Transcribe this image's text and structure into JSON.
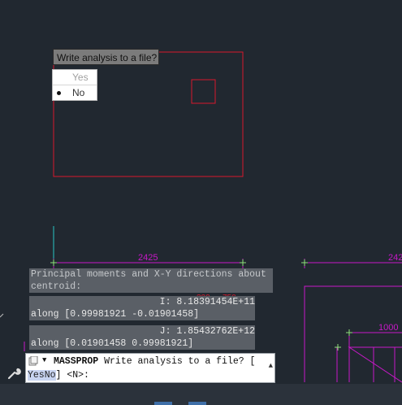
{
  "colors": {
    "background": "#212830",
    "geometry_red": "#d8182c",
    "dimension_magenta": "#c818c8",
    "axis_cyan": "#29c6c6",
    "grip_green": "#8fe07a",
    "command_panel": "#5a5f66"
  },
  "prompt": {
    "tooltip": "Write analysis to a file?",
    "options": [
      "Yes",
      "No"
    ],
    "selected": "No"
  },
  "drawing": {
    "dimensions": [
      "2425",
      "242",
      "1000"
    ],
    "partial_labels": [
      "300",
      "750"
    ]
  },
  "history": {
    "line1": "Principal moments and X-Y directions about",
    "line2": "centroid:",
    "i_value": "I: 8.18391454E+11",
    "i_along": "along [0.99981921 -0.01901458]",
    "j_value": "J: 1.85432762E+12",
    "j_along": "along [0.01901458 0.99981921]"
  },
  "command": {
    "name": "MASSPROP",
    "prompt_text": "Write analysis to a file? [",
    "option_yes": "Yes",
    "option_no": "No",
    "suffix": "] <N>:"
  },
  "icons": [
    "command-history-icon",
    "dropdown-arrow-icon",
    "wrench-icon",
    "scroll-up-icon"
  ]
}
